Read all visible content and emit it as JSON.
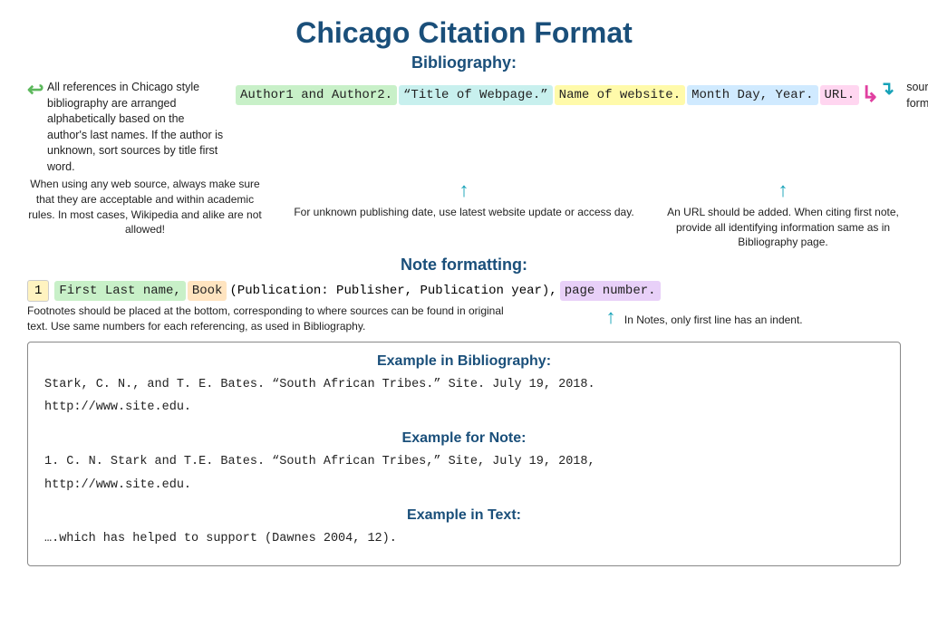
{
  "title": "Chicago Citation Format",
  "bibliography_section": {
    "label": "Bibliography:",
    "left_note": "All references in Chicago style bibliography are arranged alphabetically based on the author's last names. If the author is unknown, sort sources by title first word.",
    "right_note": "sources should be formed alphabetically",
    "citation_chunks": [
      {
        "text": "Author1 and Author2.",
        "bg": "green"
      },
      {
        "text": " "
      },
      {
        "text": "“Title of Webpage.”",
        "bg": "teal"
      },
      {
        "text": " "
      },
      {
        "text": "Name of website.",
        "bg": "yellow"
      },
      {
        "text": " "
      },
      {
        "text": "Month Day, Year.",
        "bg": "blue"
      },
      {
        "text": " "
      },
      {
        "text": "URL.",
        "bg": "pink"
      }
    ],
    "below_left": "When using any web source, always make sure that they are acceptable and within academic rules. In most cases, Wikipedia and alike are not allowed!",
    "below_mid": "For unknown publishing date, use latest website update or access day.",
    "below_right": "An URL should be added. When citing first note, provide all identifying information same as in Bibliography page."
  },
  "note_section": {
    "label": "Note formatting:",
    "number": "1",
    "note_chunks": [
      {
        "text": "First Last name,",
        "bg": "green"
      },
      {
        "text": " "
      },
      {
        "text": "Book",
        "bg": "orange"
      },
      {
        "text": " "
      },
      {
        "text": "(Publication: Publisher, Publication year),",
        "bg": "plain"
      },
      {
        "text": " "
      },
      {
        "text": "page number.",
        "bg": "purple"
      }
    ],
    "ann_left": "Footnotes should be placed at the bottom, corresponding to where sources can be found in original text. Use same numbers for each referencing, as used in Bibliography.",
    "ann_right": "In Notes, only first line has an indent."
  },
  "examples": {
    "bib_title": "Example in Bibliography:",
    "bib_line1": "Stark, C. N., and T. E. Bates. “South African Tribes.” Site. July 19, 2018.",
    "bib_line2": "http://www.site.edu.",
    "note_title": "Example for Note:",
    "note_line1": "1. C. N. Stark and T.E. Bates. “South African Tribes,” Site, July 19, 2018,",
    "note_line2": "http://www.site.edu.",
    "text_title": "Example in Text:",
    "text_line1": "….which has helped to support (Dawnes 2004, 12)."
  }
}
